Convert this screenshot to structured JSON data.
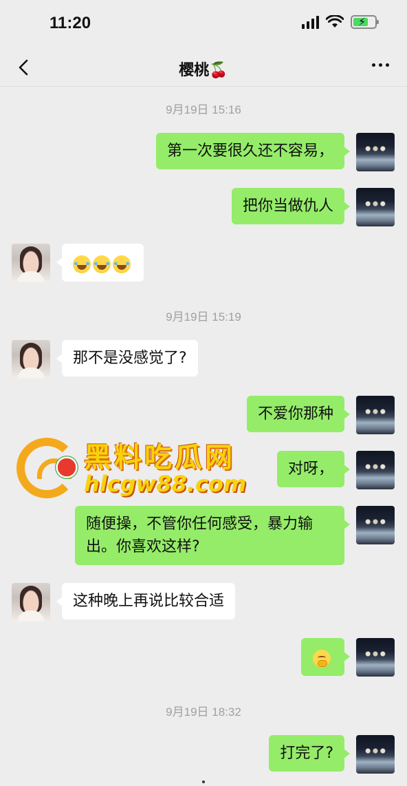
{
  "status_bar": {
    "time": "11:20"
  },
  "header": {
    "title": "樱桃🍒"
  },
  "timestamps": [
    "9月19日 15:16",
    "9月19日 15:19",
    "9月19日 18:32"
  ],
  "messages": [
    {
      "from": "self",
      "text": "第一次要很久还不容易，"
    },
    {
      "from": "self",
      "text": "把你当做仇人"
    },
    {
      "from": "other",
      "emoji": [
        "laughing-crying-emoji",
        "laughing-crying-emoji",
        "laughing-crying-emoji"
      ]
    },
    {
      "from": "other",
      "text": "那不是没感觉了?"
    },
    {
      "from": "self",
      "text": "不爱你那种"
    },
    {
      "from": "self",
      "text": "对呀，"
    },
    {
      "from": "self",
      "text": "随便操，不管你任何感受，暴力输出。你喜欢这样?"
    },
    {
      "from": "other",
      "text": "这种晚上再说比较合适"
    },
    {
      "from": "self",
      "emoji": [
        "shy-face-emoji"
      ]
    },
    {
      "from": "self",
      "text": "打完了?"
    }
  ],
  "watermark": {
    "title": "黑料吃瓜网",
    "url": "hlcgw88.com"
  },
  "colors": {
    "self_bubble": "#95ec69",
    "other_bubble": "#ffffff",
    "background": "#ededed"
  }
}
